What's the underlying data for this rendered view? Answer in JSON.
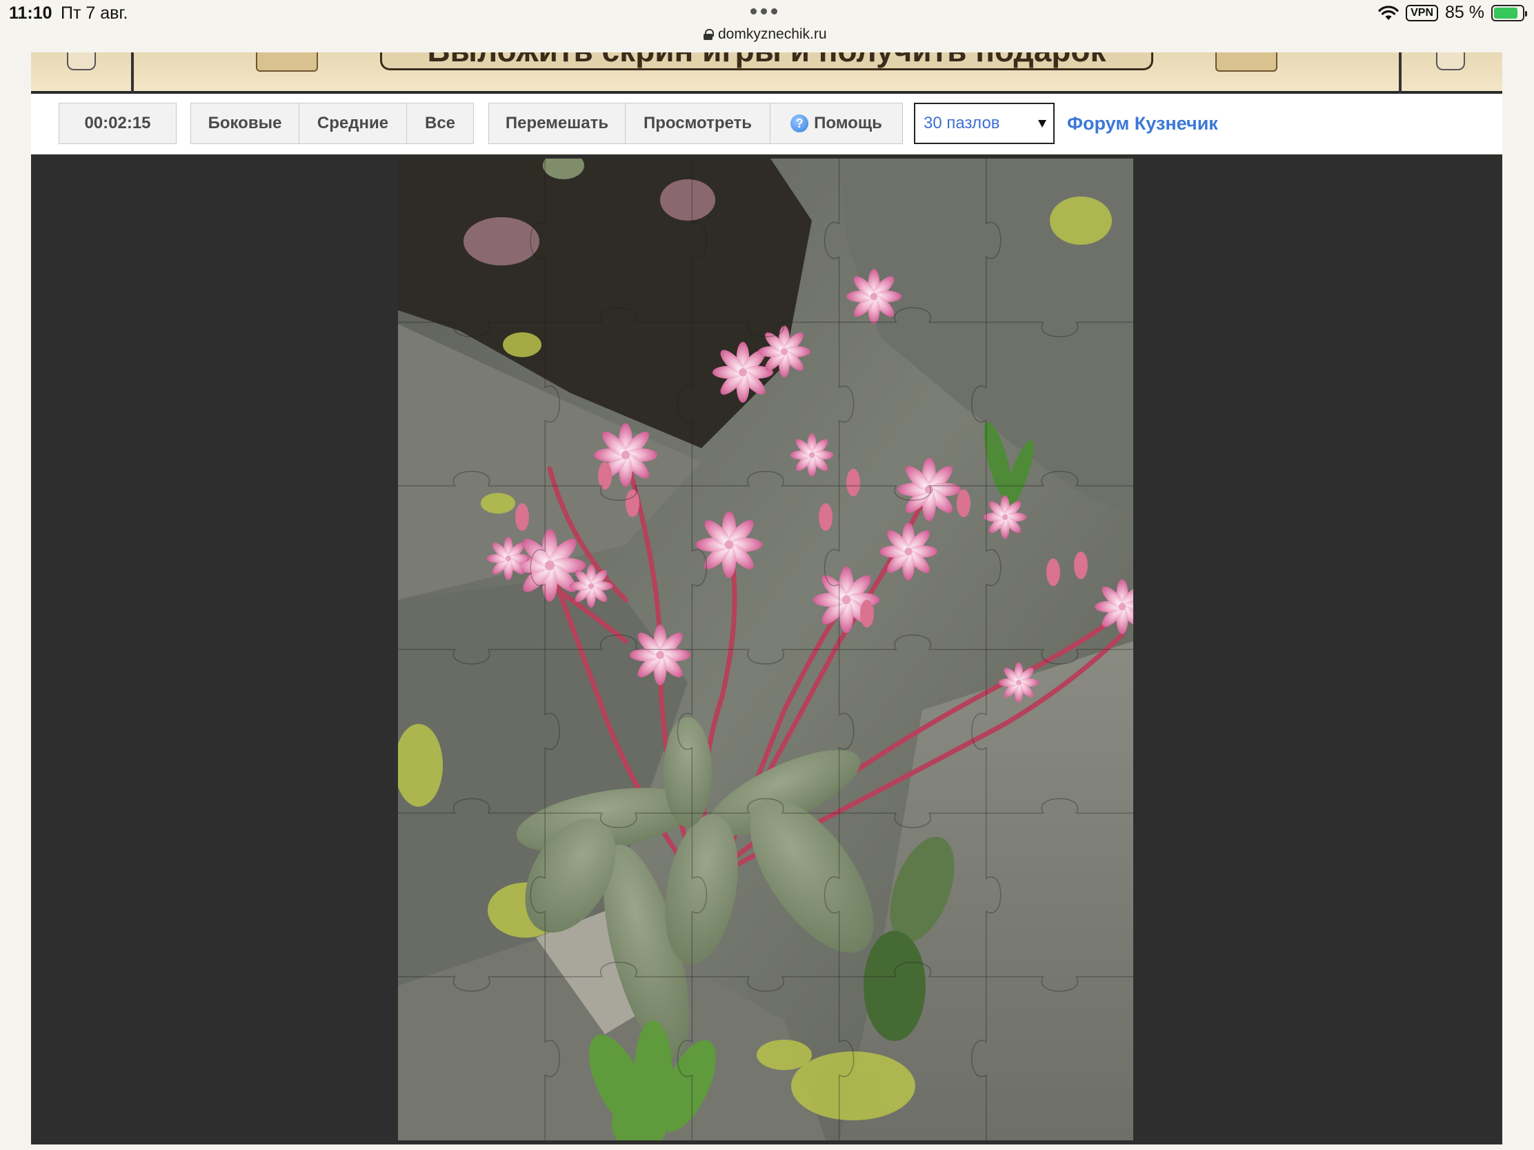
{
  "status_bar": {
    "time": "11:10",
    "date": "Пт 7 авг.",
    "url": "domkyznechik.ru",
    "vpn": "VPN",
    "battery": "85 %",
    "battery_level": 0.85
  },
  "banner": {
    "title": "Выложить скрин игры и получить подарок"
  },
  "toolbar": {
    "timer": "00:02:15",
    "filters": [
      "Боковые",
      "Средние",
      "Все"
    ],
    "actions": {
      "shuffle": "Перемешать",
      "preview": "Просмотреть",
      "help": "Помощь"
    },
    "pieces_select": {
      "selected": "30 пазлов"
    },
    "forum_link": "Форум Кузнечик"
  },
  "puzzle": {
    "columns": 5,
    "rows": 6,
    "pieces": 30,
    "image_subject": "pink-flowers-on-rock"
  },
  "colors": {
    "board_bg": "#2e2e2e",
    "link": "#3c78d8",
    "select_text": "#3e6fd6",
    "battery_green": "#35c759"
  }
}
